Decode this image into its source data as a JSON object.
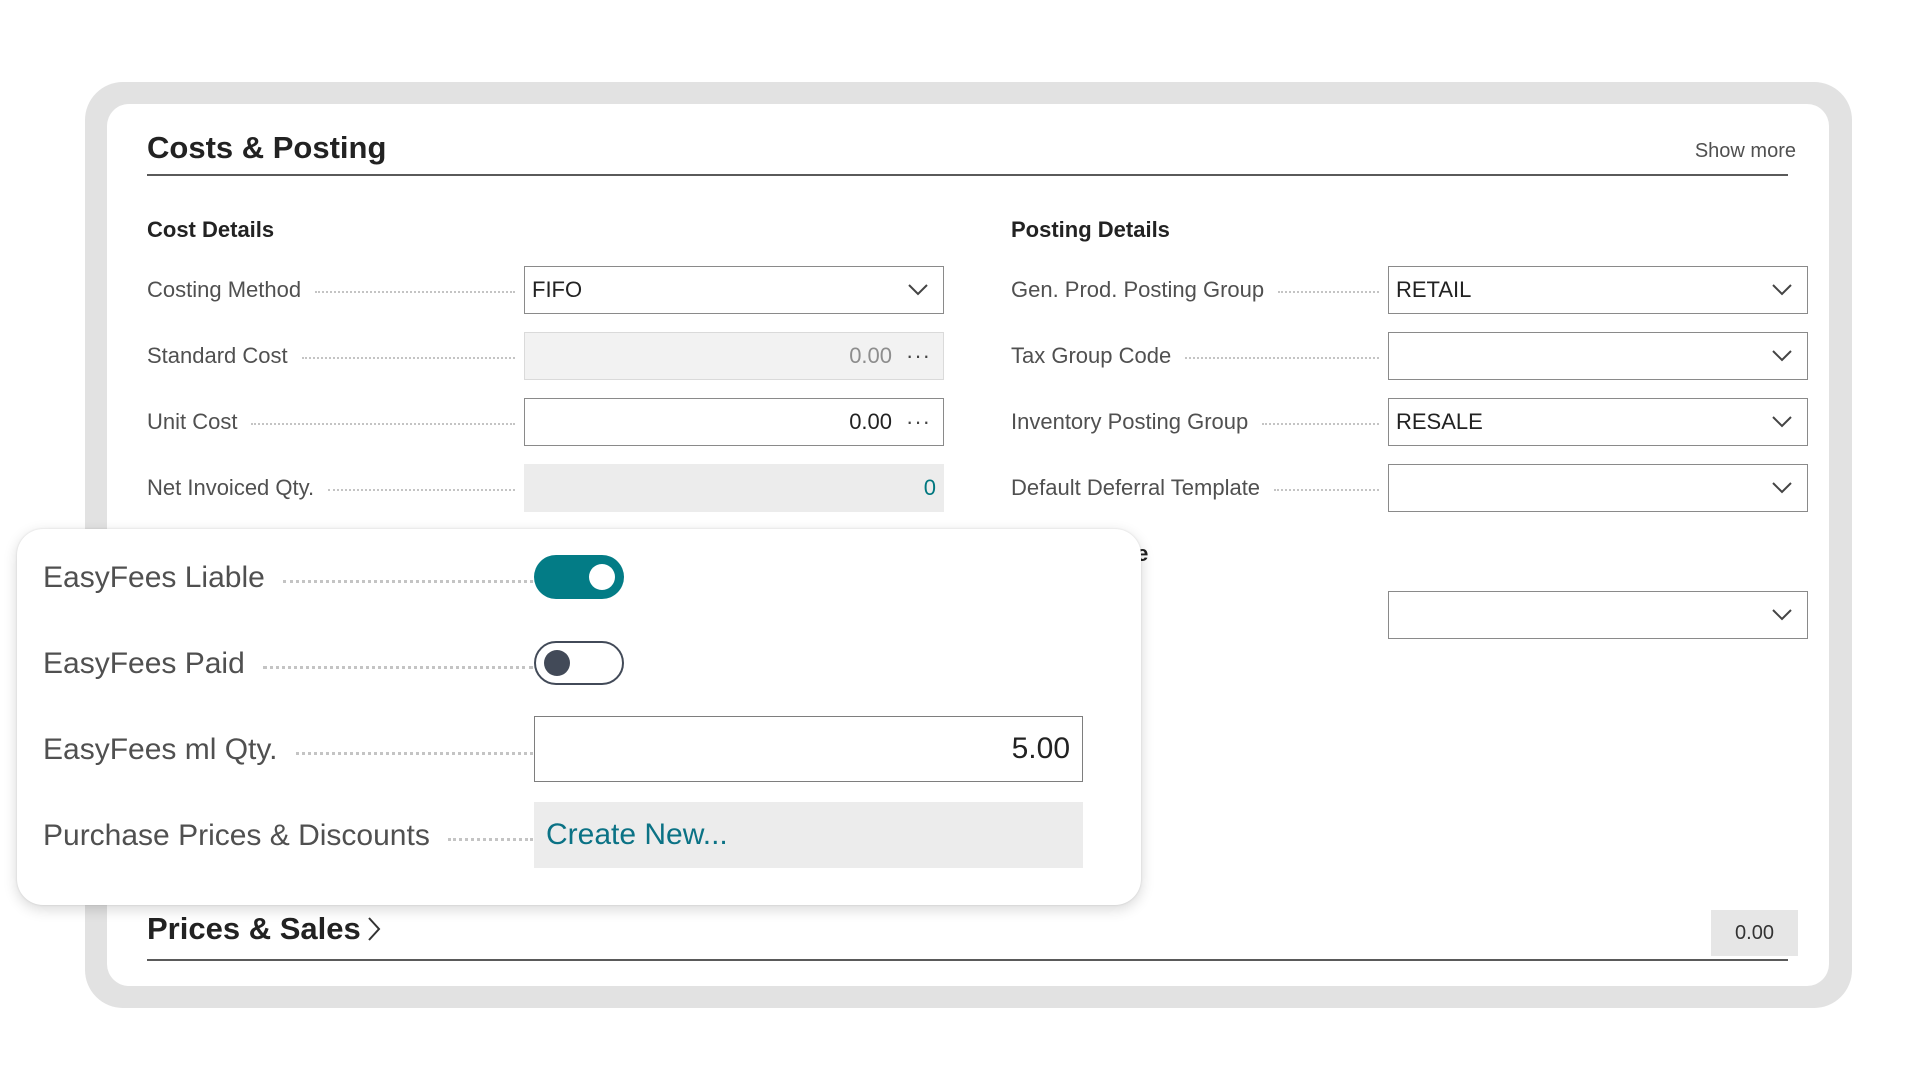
{
  "costs_posting": {
    "title": "Costs & Posting",
    "show_more": "Show more",
    "cost_details": {
      "heading": "Cost Details",
      "costing_method": {
        "label": "Costing Method",
        "value": "FIFO"
      },
      "standard_cost": {
        "label": "Standard Cost",
        "value": "0.00"
      },
      "unit_cost": {
        "label": "Unit Cost",
        "value": "0.00"
      },
      "net_invoiced_qty": {
        "label": "Net Invoiced Qty.",
        "value": "0"
      }
    },
    "posting_details": {
      "heading": "Posting Details",
      "gen_prod_posting_group": {
        "label": "Gen. Prod. Posting Group",
        "value": "RETAIL"
      },
      "tax_group_code": {
        "label": "Tax Group Code",
        "value": ""
      },
      "inventory_posting_group": {
        "label": "Inventory Posting Group",
        "value": "RESALE"
      },
      "default_deferral_template": {
        "label": "Default Deferral Template",
        "value": ""
      },
      "partial_heading": "le",
      "partial_field_value": ""
    }
  },
  "easyfees_popup": {
    "liable": {
      "label": "EasyFees Liable",
      "on": true
    },
    "paid": {
      "label": "EasyFees Paid",
      "on": false
    },
    "ml_qty": {
      "label": "EasyFees ml Qty.",
      "value": "5.00"
    },
    "purchase_prices": {
      "label": "Purchase Prices & Discounts",
      "action": "Create New..."
    }
  },
  "prices_sales": {
    "title": "Prices & Sales",
    "value": "0.00"
  },
  "icons": {
    "dropdown": "chevron-down-icon",
    "lookup": "ellipsis-icon",
    "expand": "chevron-right-icon"
  },
  "colors": {
    "accent": "#037c86",
    "link": "#0b7285",
    "toggle_off": "#424a58"
  }
}
